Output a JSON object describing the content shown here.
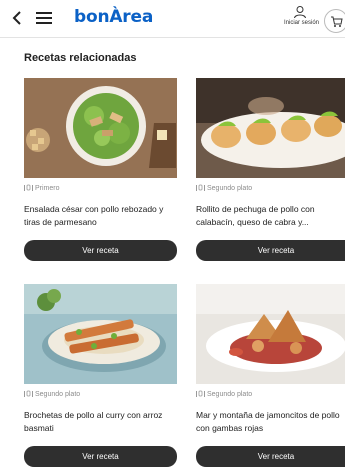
{
  "header": {
    "logo_text": "bonÀrea",
    "account_label": "Iniciar sesión"
  },
  "section_title": "Recetas relacionadas",
  "recipes": [
    {
      "meta": "Primero",
      "title": "Ensalada césar con pollo rebozado y tiras de parmesano",
      "button": "Ver receta"
    },
    {
      "meta": "Segundo plato",
      "title": "Rollito de pechuga de pollo con calabacín, queso de cabra y...",
      "button": "Ver receta"
    },
    {
      "meta": "Segundo plato",
      "title": "Brochetas de pollo al curry con arroz basmati",
      "button": "Ver receta"
    },
    {
      "meta": "Segundo plato",
      "title": "Mar y montaña de jamoncitos de pollo con gambas rojas",
      "button": "Ver receta"
    }
  ],
  "colors": {
    "brand": "#0b61c6",
    "button": "#2f2f2f"
  },
  "icons": {
    "back": "chevron-left-icon",
    "menu": "hamburger-menu-icon",
    "account": "user-icon",
    "cart": "cart-icon",
    "meta": "plate-icon"
  }
}
